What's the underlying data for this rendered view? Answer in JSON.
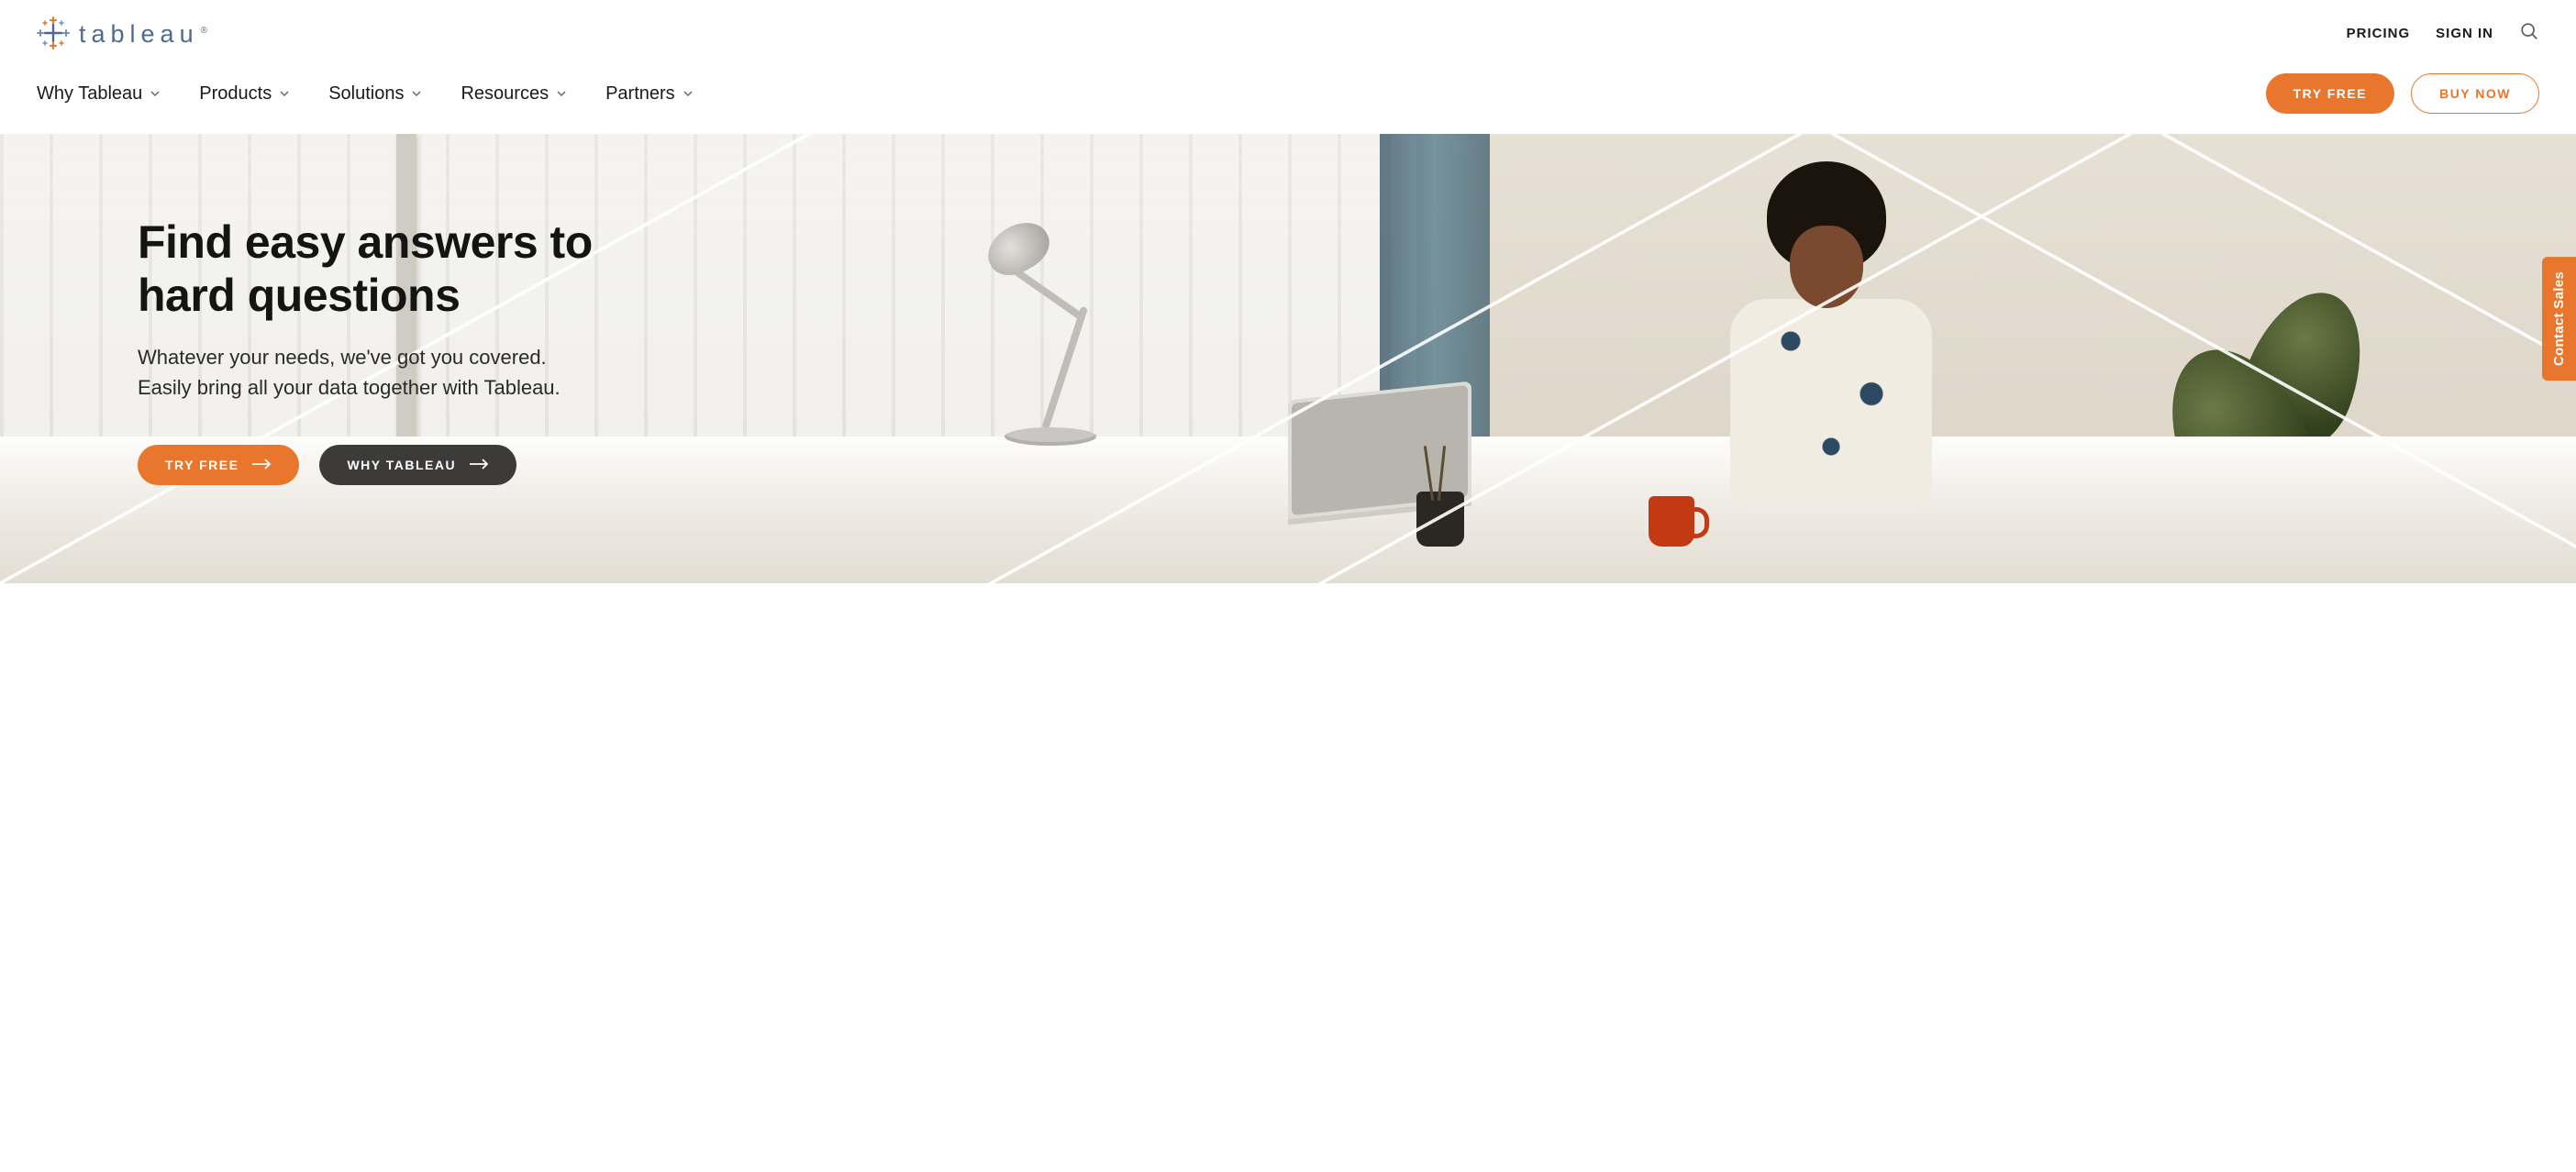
{
  "brand": {
    "name": "tableau",
    "colors": {
      "accent": "#e8762c",
      "dark": "#3c3b3a",
      "text": "#1a1a1a",
      "logo": "#4f6a8f"
    }
  },
  "header": {
    "top_links": {
      "pricing": "PRICING",
      "sign_in": "SIGN IN"
    },
    "nav": {
      "why": "Why Tableau",
      "products": "Products",
      "solutions": "Solutions",
      "resources": "Resources",
      "partners": "Partners"
    },
    "cta": {
      "try_free": "TRY FREE",
      "buy_now": "BUY NOW"
    }
  },
  "hero": {
    "title_line1": "Find easy answers to",
    "title_line2": "hard questions",
    "subtitle_line1": "Whatever your needs, we've got you covered.",
    "subtitle_line2": "Easily bring all your data together with Tableau.",
    "cta_primary": "TRY FREE",
    "cta_secondary": "WHY TABLEAU"
  },
  "side_tab": {
    "label": "Contact Sales"
  }
}
